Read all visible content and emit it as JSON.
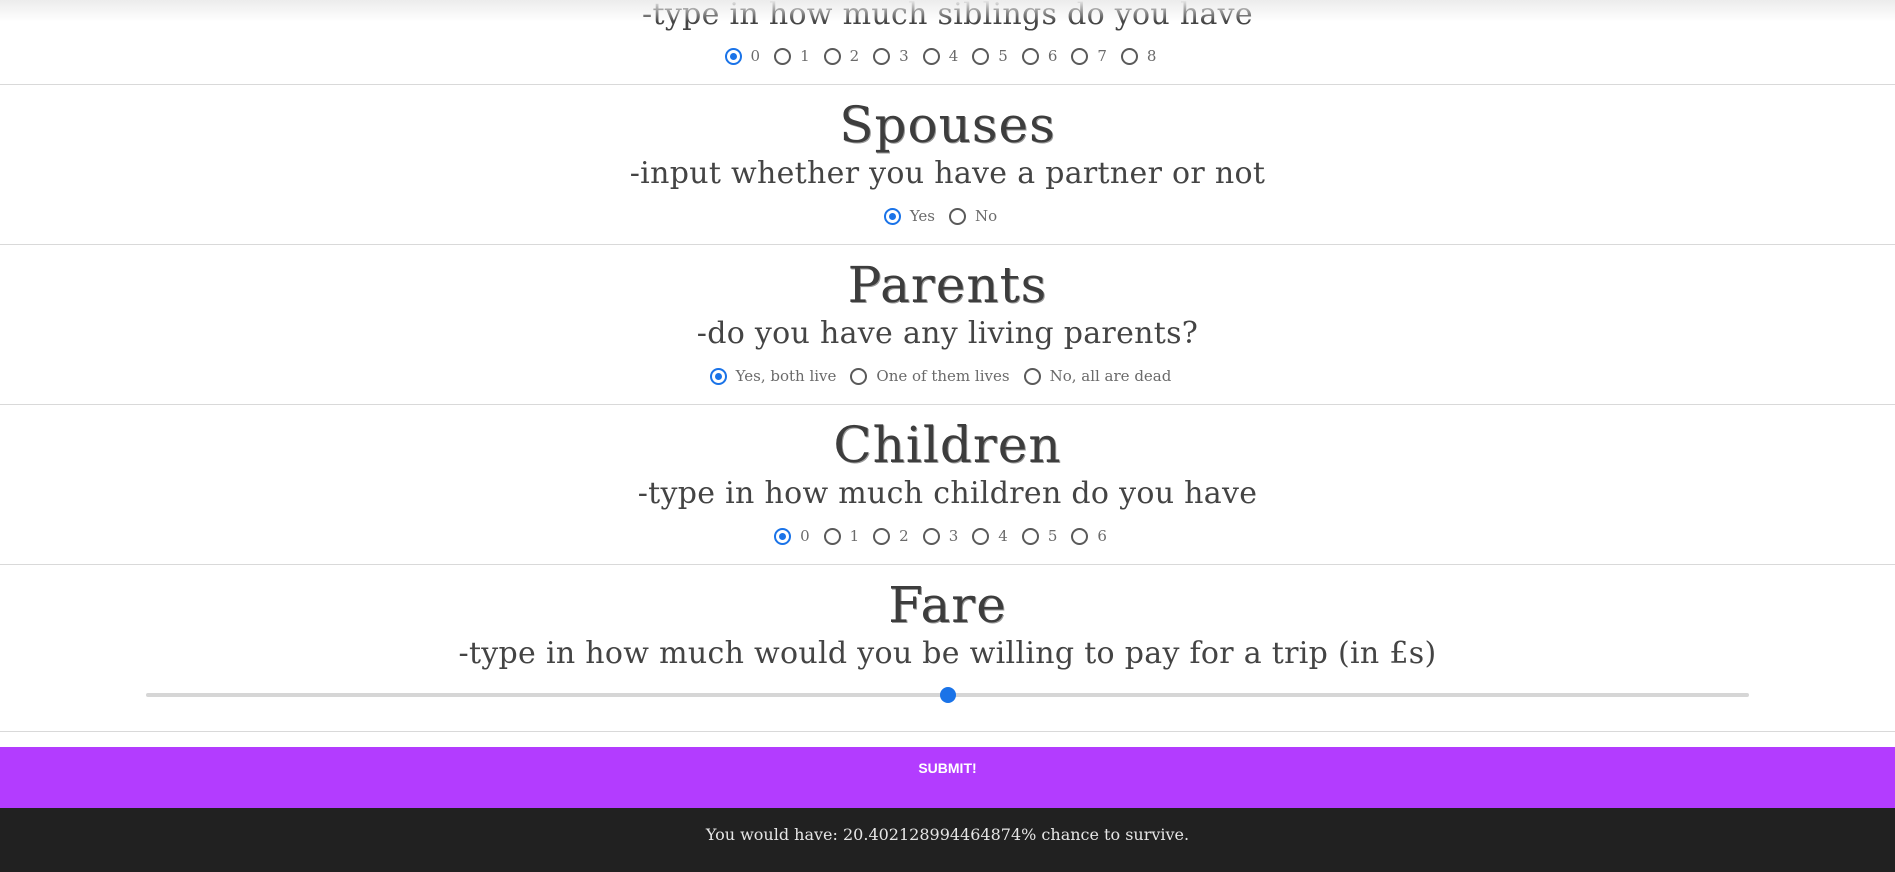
{
  "sections": {
    "siblings": {
      "subtitle": "-type in how much siblings do you have",
      "options": [
        "0",
        "1",
        "2",
        "3",
        "4",
        "5",
        "6",
        "7",
        "8"
      ],
      "selected": "0"
    },
    "spouses": {
      "title": "Spouses",
      "subtitle": "-input whether you have a partner or not",
      "options": [
        "Yes",
        "No"
      ],
      "selected": "Yes"
    },
    "parents": {
      "title": "Parents",
      "subtitle": "-do you have any living parents?",
      "options": [
        "Yes, both live",
        "One of them lives",
        "No, all are dead"
      ],
      "selected": "Yes, both live"
    },
    "children": {
      "title": "Children",
      "subtitle": "-type in how much children do you have",
      "options": [
        "0",
        "1",
        "2",
        "3",
        "4",
        "5",
        "6"
      ],
      "selected": "0"
    },
    "fare": {
      "title": "Fare",
      "subtitle": "-type in how much would you be willing to pay for a trip (in £s)",
      "slider_fraction": 0.5
    }
  },
  "submit": {
    "label": "SUBMIT!"
  },
  "result": {
    "text": "You would have: 20.402128994464874% chance to survive."
  },
  "colors": {
    "accent": "#1a73e8",
    "submit_bg": "#b33cff",
    "result_bg": "#212121"
  }
}
